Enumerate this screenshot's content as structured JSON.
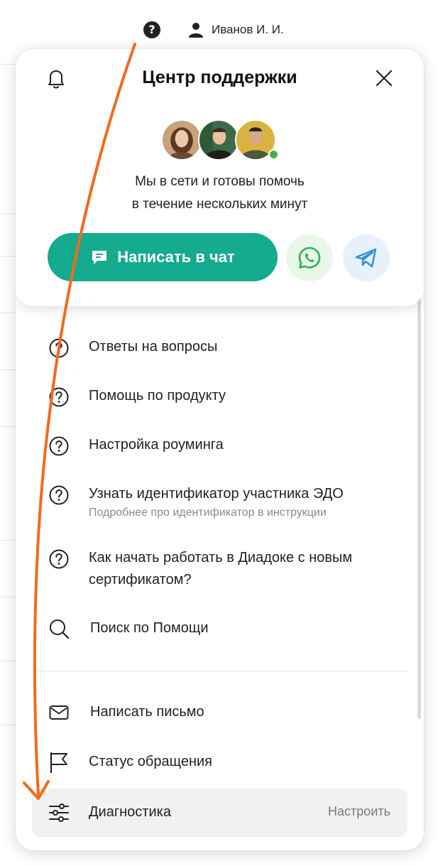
{
  "topbar": {
    "help_icon": "question-circle-icon",
    "user_icon": "user-icon",
    "user_name": "Иванов И. И."
  },
  "support": {
    "title": "Центр поддержки",
    "bell_icon": "bell-icon",
    "close_icon": "close-icon",
    "status_line1": "Мы в сети и готовы помочь",
    "status_line2": "в течение нескольких минут",
    "chat_button": "Написать в чат",
    "whatsapp_icon": "whatsapp-icon",
    "telegram_icon": "telegram-icon",
    "online_color": "#3fb24a",
    "accent_color": "#15ab8e"
  },
  "menu": {
    "faq": "Ответы на вопросы",
    "product_help": "Помощь по продукту",
    "roaming": "Настройка роуминга",
    "edo_id": "Узнать идентификатор участника ЭДО",
    "edo_id_sub": "Подробнее про идентификатор в инструкции",
    "new_cert_line1": "Как начать работать в Диадоке с новым",
    "new_cert_line2": "сертификатом?",
    "search": "Поиск по Помощи",
    "write_letter": "Написать письмо",
    "request_status": "Статус обращения",
    "diagnostics": "Диагностика",
    "diagnostics_action": "Настроить"
  },
  "annotation": {
    "arrow_color": "#f26a1b"
  }
}
